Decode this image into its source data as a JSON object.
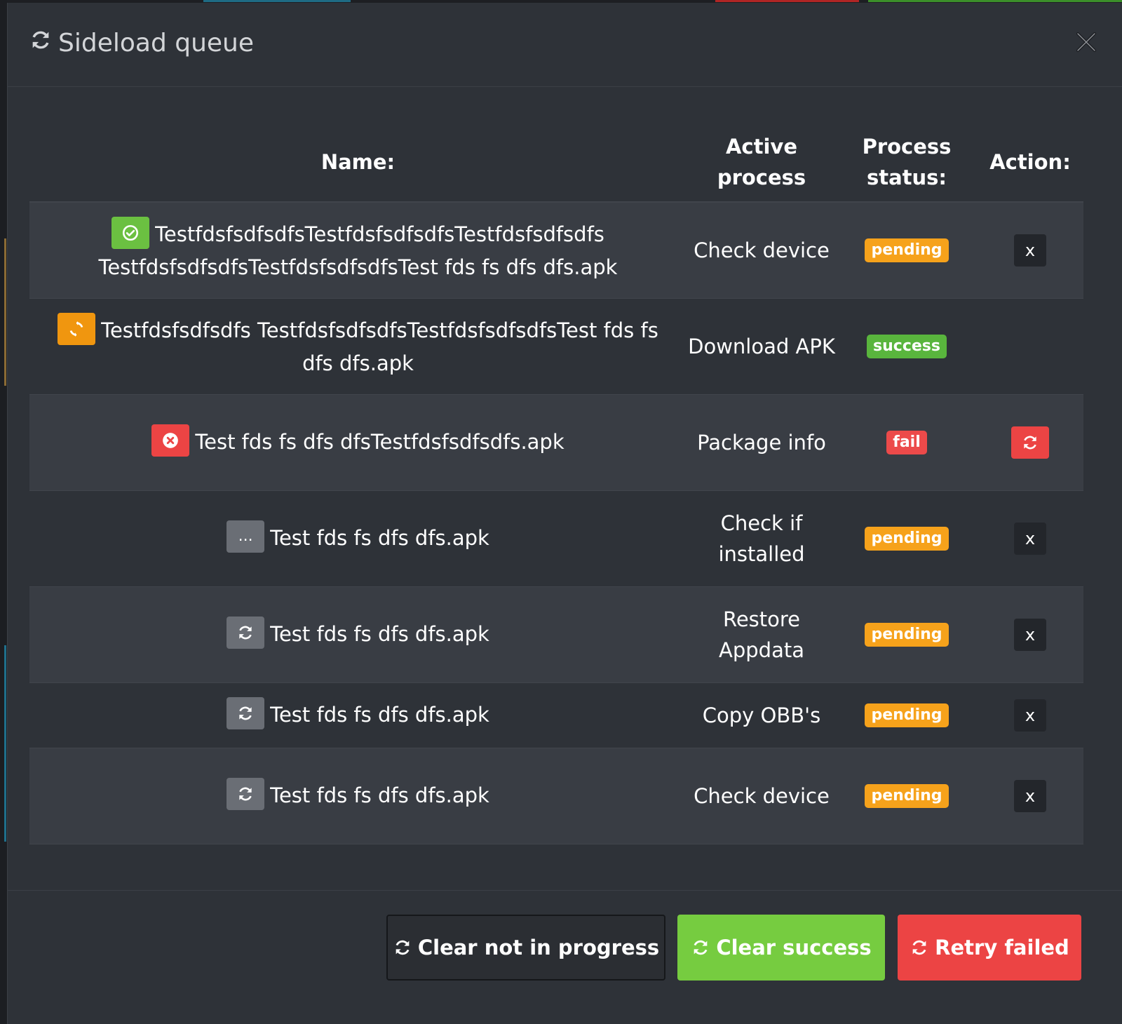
{
  "modal": {
    "title": "Sideload queue",
    "title_icon": "refresh-icon",
    "close_label": "×"
  },
  "table": {
    "headers": {
      "name": "Name:",
      "active_process": "Active process",
      "process_status": "Process status:",
      "action": "Action:"
    },
    "rows": [
      {
        "state": "success",
        "state_icon": "check-circle-icon",
        "name": "TestfdsfsdfsdfsTestfdsfsdfsdfsTestfdsfsdfsdfs TestfdsfsdfsdfsTestfdsfsdfsdfsTest fds fs dfs dfs.apk",
        "active_process": "Check device",
        "status": "pending",
        "action": "x"
      },
      {
        "state": "in-progress",
        "state_icon": "spinner-icon",
        "name": "Testfdsfsdfsdfs TestfdsfsdfsdfsTestfdsfsdfsdfsTest fds fs dfs dfs.apk",
        "active_process": "Download APK",
        "status": "success",
        "action": ""
      },
      {
        "state": "fail",
        "state_icon": "x-circle-icon",
        "name": "Test fds fs dfs dfsTestfdsfsdfsdfs.apk",
        "active_process": "Package info",
        "status": "fail",
        "action": "retry"
      },
      {
        "state": "waiting",
        "state_icon": "ellipsis-icon",
        "state_text": "...",
        "name": "Test fds fs dfs dfs.apk",
        "active_process": "Check if installed",
        "status": "pending",
        "action": "x"
      },
      {
        "state": "queued",
        "state_icon": "refresh-icon",
        "name": "Test fds fs dfs dfs.apk",
        "active_process": "Restore Appdata",
        "status": "pending",
        "action": "x"
      },
      {
        "state": "queued",
        "state_icon": "refresh-icon",
        "name": "Test fds fs dfs dfs.apk",
        "active_process": "Copy OBB's",
        "status": "pending",
        "action": "x"
      },
      {
        "state": "queued",
        "state_icon": "refresh-icon",
        "name": "Test fds fs dfs dfs.apk",
        "active_process": "Check device",
        "status": "pending",
        "action": "x"
      }
    ]
  },
  "footer": {
    "clear_not_in_progress": "Clear not in progress",
    "clear_success": "Clear success",
    "retry_failed": "Retry failed"
  },
  "colors": {
    "pending": "#f6a21b",
    "success": "#59b53d",
    "fail": "#ec4a4a",
    "clear_success_button": "#76cc40",
    "retry_button": "#ec4444"
  }
}
